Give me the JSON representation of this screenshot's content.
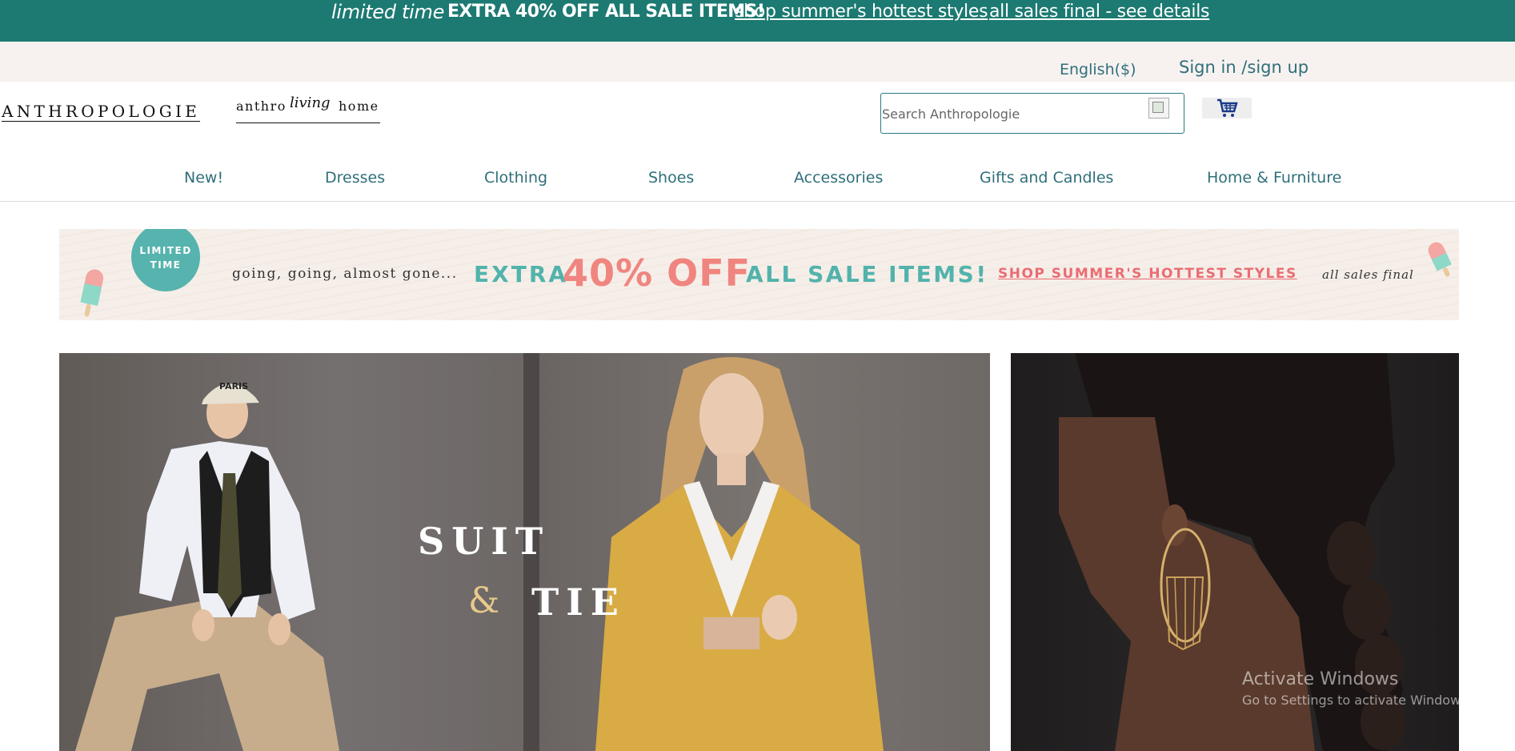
{
  "promo_bar": {
    "limited": "limited time",
    "extra": "EXTRA 40% OFF ALL SALE ITEMS!",
    "shop_link": "shop summer's hottest styles",
    "final_link": "all sales final - see details"
  },
  "utility": {
    "language": "English($)",
    "signin": "Sign in /sign up"
  },
  "header": {
    "logo": "ANTHROPOLOGIE",
    "home_logo_a": "anthro",
    "home_logo_b": "living",
    "home_logo_c": "home",
    "search_placeholder": "Search Anthropologie"
  },
  "nav": {
    "items": [
      "New!",
      "Dresses",
      "Clothing",
      "Shoes",
      "Accessories",
      "Gifts and Candles",
      "Home & Furniture"
    ]
  },
  "sale_banner": {
    "badge_line1": "LIMITED",
    "badge_line2": "TIME",
    "going": "going, going, almost gone...",
    "extra": "EXTRA",
    "percent": "40% OFF",
    "all_items": "ALL SALE ITEMS!",
    "shop_link": "SHOP SUMMER'S HOTTEST STYLES",
    "final": "all sales final"
  },
  "hero": {
    "suit": "SUIT",
    "amp": "&",
    "tie": "TIE",
    "cap_text": "PARIS"
  },
  "watermark": {
    "title": "Activate Windows",
    "subtitle": "Go to Settings to activate Windows."
  },
  "colors": {
    "teal_bar": "#1c7a72",
    "nav_text": "#2f6f7a",
    "sale_teal": "#52b3ac",
    "sale_coral": "#f08580"
  },
  "icons": [
    "cart-icon",
    "search-icon",
    "popsicle-icon"
  ]
}
